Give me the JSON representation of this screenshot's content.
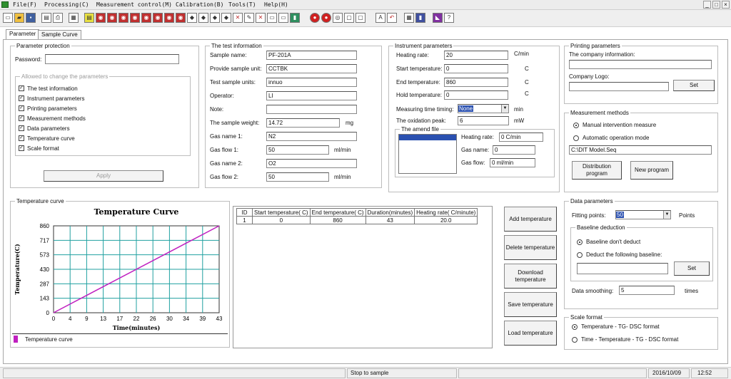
{
  "menu": [
    {
      "label": "File(F)"
    },
    {
      "label": "Processing(C)"
    },
    {
      "label": "Measurement control(M)"
    },
    {
      "label": "Calibration(B)"
    },
    {
      "label": "Tools(T)"
    },
    {
      "label": "Help(H)"
    }
  ],
  "window_buttons": [
    "_",
    "□",
    "×"
  ],
  "tabs": [
    {
      "label": "Parameter"
    },
    {
      "label": "Sample Curve"
    }
  ],
  "protection": {
    "title": "Parameter protection",
    "password_label": "Password:",
    "password_value": "",
    "allowed_title": "Allowed to change the parameters",
    "items": [
      {
        "label": "The test information",
        "checked": true
      },
      {
        "label": "Instrument parameters",
        "checked": true
      },
      {
        "label": "Printing parameters",
        "checked": true
      },
      {
        "label": "Measurement methods",
        "checked": true
      },
      {
        "label": "Data parameters",
        "checked": true
      },
      {
        "label": "Temperature curve",
        "checked": true
      },
      {
        "label": "Scale format",
        "checked": true
      }
    ],
    "apply_label": "Apply"
  },
  "test_info": {
    "title": "The test information",
    "sample_name": {
      "label": "Sample name:",
      "value": "PF-201A"
    },
    "provide_unit": {
      "label": "Provide sample unit:",
      "value": "CCTBK"
    },
    "test_units": {
      "label": "Test sample units:",
      "value": "innuo"
    },
    "operator": {
      "label": "Operator:",
      "value": "LI"
    },
    "note": {
      "label": "Note:",
      "value": ""
    },
    "weight": {
      "label": "The sample weight:",
      "value": "14.72",
      "unit": "mg"
    },
    "gas_name1": {
      "label": "Gas name 1:",
      "value": "N2"
    },
    "gas_flow1": {
      "label": "Gas flow 1:",
      "value": "50",
      "unit": "ml/min"
    },
    "gas_name2": {
      "label": "Gas name 2:",
      "value": "O2"
    },
    "gas_flow2": {
      "label": "Gas flow 2:",
      "value": "50",
      "unit": "ml/min"
    }
  },
  "instrument": {
    "title": "Instrument parameters",
    "heating_rate": {
      "label": "Heating rate:",
      "value": "20",
      "unit": "C/min"
    },
    "start_temp": {
      "label": "Start temperature:",
      "value": "0",
      "unit": "C"
    },
    "end_temp": {
      "label": "End temperature:",
      "value": "860",
      "unit": "C"
    },
    "hold_temp": {
      "label": "Hold temperature:",
      "value": "0",
      "unit": "C"
    },
    "timing": {
      "label": "Measuring time timing:",
      "value": "None",
      "unit": "min"
    },
    "oxidation": {
      "label": "The oxidation peak:",
      "value": "6",
      "unit": "mW"
    },
    "amend": {
      "title": "The amend file",
      "heating_rate_label": "Heating rate:",
      "heating_rate_value": "0  C/min",
      "gas_name_label": "Gas name:",
      "gas_name_value": "0",
      "gas_flow_label": "Gas flow:",
      "gas_flow_value": "0 ml/min"
    }
  },
  "printing": {
    "title": "Printing parameters",
    "company_label": "The company information:",
    "company_value": "",
    "logo_label": "Company Logo:",
    "logo_value": "",
    "set_label": "Set"
  },
  "methods": {
    "title": "Measurement methods",
    "manual_label": "Manual intervention measure",
    "auto_label": "Automatic operation mode",
    "selected": "manual",
    "path_value": "C:\\DIT Model.Seq",
    "distribution_label": "Distribution program",
    "new_label": "New program"
  },
  "temp_curve": {
    "frame_title": "Temperature curve",
    "legend_label": "Temperature curve",
    "series_color": "#c020c0"
  },
  "chart_data": {
    "type": "line",
    "title": "Temperature Curve",
    "xlabel": "Time(minutes)",
    "ylabel": "Temperature(C)",
    "xlim": [
      0,
      43
    ],
    "ylim": [
      0,
      860
    ],
    "xticks": [
      "0",
      "4",
      "9",
      "13",
      "17",
      "22",
      "26",
      "30",
      "34",
      "39",
      "43"
    ],
    "yticks": [
      "0",
      "143",
      "287",
      "430",
      "573",
      "717",
      "860"
    ],
    "grid": true,
    "series": [
      {
        "name": "Temperature curve",
        "color": "#c020c0",
        "x": [
          0,
          43
        ],
        "y": [
          0,
          860
        ]
      }
    ]
  },
  "segment_table": {
    "columns": [
      "ID",
      "Start temperature( C)",
      "End temperature( C)",
      "Duration(minutes)",
      "Heating rate( C/minute)"
    ],
    "rows": [
      [
        "1",
        "0",
        "860",
        "43",
        "20.0"
      ]
    ]
  },
  "segment_buttons": {
    "add": "Add temperature",
    "delete": "Delete temperature",
    "download": "Download temperature",
    "save": "Save temperature",
    "load": "Load temperature"
  },
  "data_params": {
    "title": "Data parameters",
    "fitting_label": "Fitting points:",
    "fitting_value": "50",
    "fitting_unit": "Points",
    "baseline_title": "Baseline deduction",
    "baseline_none": "Baseline don't deduct",
    "baseline_follow": "Deduct the following baseline:",
    "baseline_selected": "none",
    "baseline_value": "",
    "set_label": "Set",
    "smoothing_label": "Data smoothing:",
    "smoothing_value": "5",
    "smoothing_unit": "times"
  },
  "scale": {
    "title": "Scale format",
    "opt1": "Temperature - TG- DSC format",
    "opt2": "Time - Temperature - TG - DSC format",
    "selected": "opt1"
  },
  "status": {
    "message": "Stop to sample",
    "date": "2016/10/09",
    "time": "12:52"
  }
}
